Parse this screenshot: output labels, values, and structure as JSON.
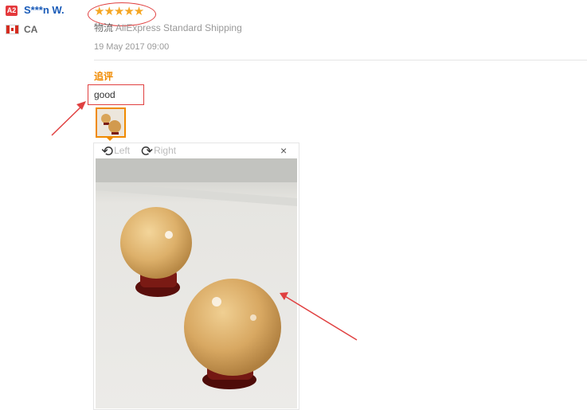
{
  "reviewer": {
    "level_badge": "A2",
    "name": "S***n W.",
    "country": "CA"
  },
  "review": {
    "rating_stars": "★★★★★",
    "shipping_label": "物流",
    "shipping_method": "AliExpress Standard Shipping",
    "date": "19 May 2017 09:00",
    "followup_label": "追评",
    "feedback_text": "good"
  },
  "viewer": {
    "rotate_left": "Left",
    "rotate_right": "Right",
    "close": "×"
  },
  "colors": {
    "accent": "#f08a00",
    "link": "#1a5bb8",
    "annotation": "#e04040",
    "star": "#f5a623"
  }
}
